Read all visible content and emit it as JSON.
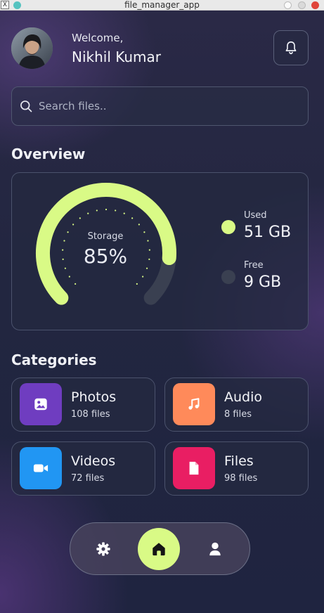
{
  "window": {
    "title": "file_manager_app",
    "app_icon_glyph": "X"
  },
  "header": {
    "welcome": "Welcome,",
    "user_name": "Nikhil Kumar"
  },
  "search": {
    "placeholder": "Search files.."
  },
  "overview": {
    "title": "Overview",
    "gauge_label": "Storage",
    "percent_text": "85%",
    "percent_value": 85,
    "used_label": "Used",
    "used_value": "51 GB",
    "free_label": "Free",
    "free_value": "9 GB"
  },
  "categories": {
    "title": "Categories",
    "items": [
      {
        "name": "Photos",
        "count": "108 files",
        "color": "#6f3dc0",
        "icon": "image-icon"
      },
      {
        "name": "Audio",
        "count": "8 files",
        "color": "#ff8a5a",
        "icon": "music-note-icon"
      },
      {
        "name": "Videos",
        "count": "72 files",
        "color": "#2196f3",
        "icon": "video-camera-icon"
      },
      {
        "name": "Files",
        "count": "98 files",
        "color": "#e91e63",
        "icon": "document-icon"
      }
    ]
  },
  "bottom_nav": {
    "items": [
      "gear-icon",
      "home-icon",
      "user-icon"
    ],
    "active": "home-icon"
  },
  "colors": {
    "accent": "#d9fa86",
    "track": "#3a4051",
    "background": "#222640",
    "card": "#262b43"
  }
}
